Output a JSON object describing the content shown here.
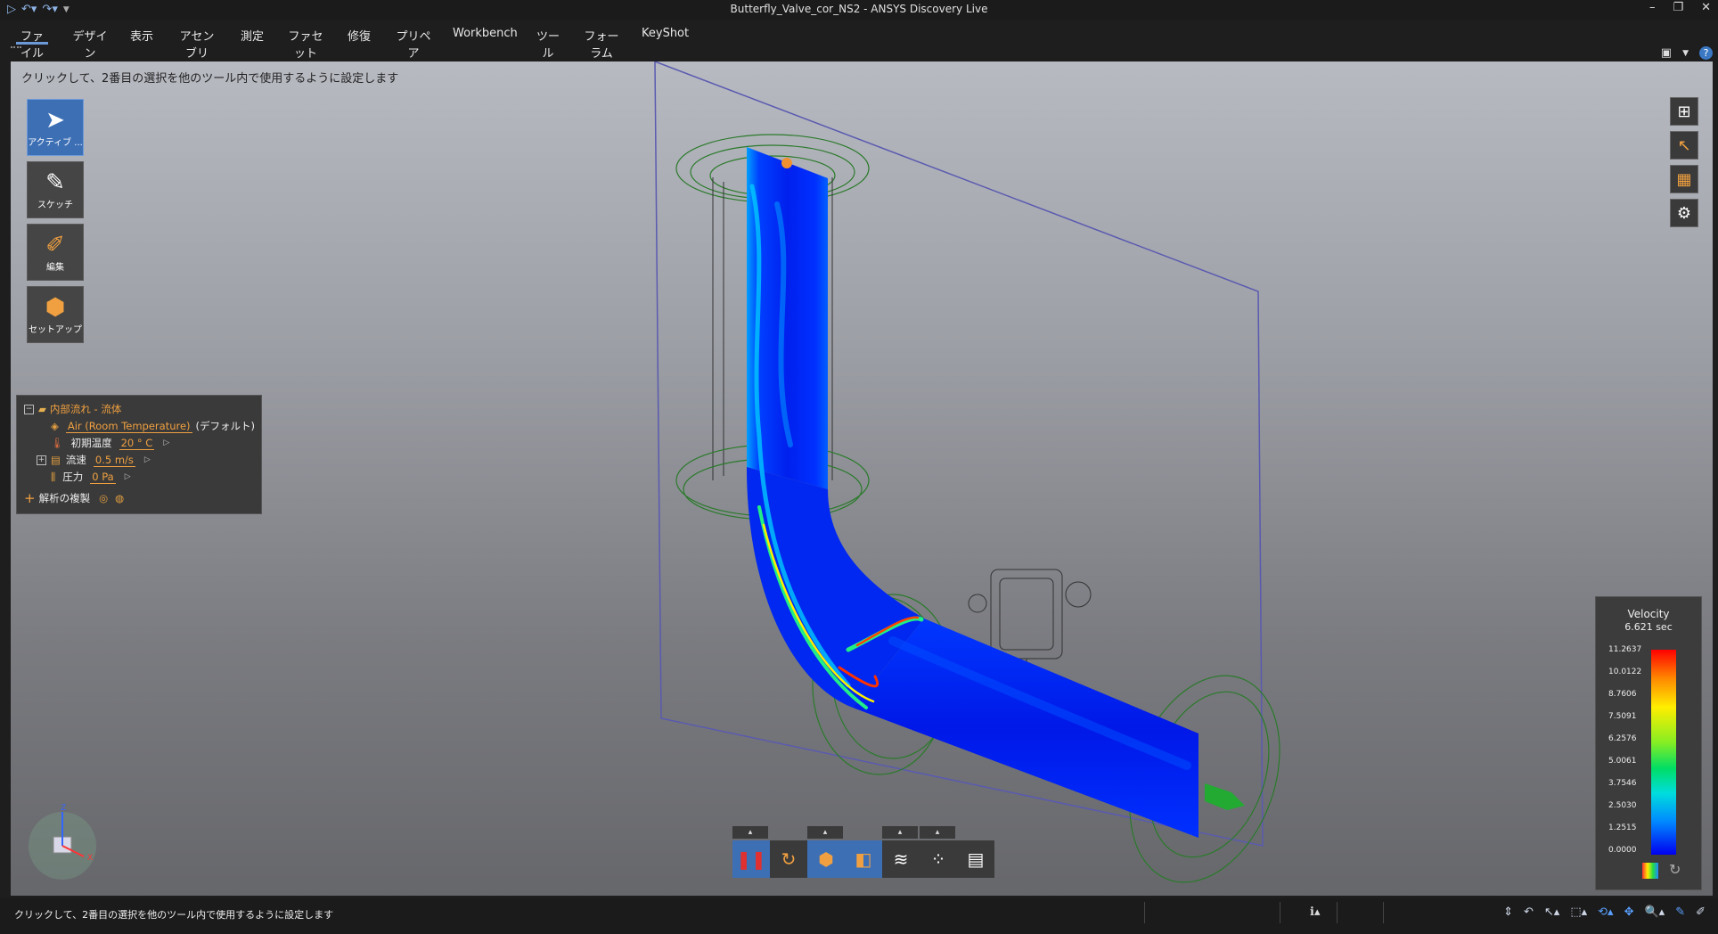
{
  "window": {
    "title": "Butterfly_Valve_cor_NS2 - ANSYS Discovery Live",
    "controls": [
      "minimize-icon",
      "restore-icon",
      "close-icon"
    ]
  },
  "quick_access": [
    "play-logo-icon",
    "undo-icon",
    "redo-icon",
    "customize-icon"
  ],
  "menu": [
    {
      "label": "ファイル",
      "active": true
    },
    {
      "label": "デザイン"
    },
    {
      "label": "表示"
    },
    {
      "label": "アセンブリ"
    },
    {
      "label": "測定"
    },
    {
      "label": "ファセット"
    },
    {
      "label": "修復"
    },
    {
      "label": "プリペア"
    },
    {
      "label": "Workbench"
    },
    {
      "label": "ツール"
    },
    {
      "label": "フォーラム"
    },
    {
      "label": "KeyShot"
    }
  ],
  "viewport": {
    "hint": "クリックして、2番目の選択を他のツール内で使用するように設定します"
  },
  "tools": [
    {
      "label": "アクティブ ...",
      "icon": "cursor-icon",
      "active": true
    },
    {
      "label": "スケッチ",
      "icon": "pencil-icon"
    },
    {
      "label": "編集",
      "icon": "edit-brush-icon"
    },
    {
      "label": "セットアップ",
      "icon": "setup-box-icon"
    }
  ],
  "physics_tree": {
    "root": "内部流れ - 流体",
    "material": "Air (Room Temperature)",
    "material_suffix": "(デフォルト)",
    "temperature_label": "初期温度",
    "temperature_value": "20 ° C",
    "velocity_label": "流速",
    "velocity_value": "0.5 m/s",
    "pressure_label": "圧力",
    "pressure_value": "0 Pa",
    "duplicate_label": "解析の複製"
  },
  "legend": {
    "title": "Velocity",
    "time": "6.621 sec",
    "ticks": [
      "11.2637",
      "10.0122",
      "8.7606",
      "7.5091",
      "6.2576",
      "5.0061",
      "3.7546",
      "2.5030",
      "1.2515",
      "0.0000"
    ],
    "colors": {
      "max": "#ff0000",
      "mid": "#88ee22",
      "min": "#0000ee"
    }
  },
  "playbar": {
    "buttons": [
      "pause-icon",
      "reset-icon",
      "solid-view-icon",
      "section-view-icon",
      "streamlines-icon",
      "particles-icon",
      "surface-texture-icon"
    ]
  },
  "status": {
    "text": "クリックして、2番目の選択を他のツール内で使用するように設定します",
    "icons": [
      "info-icon",
      "selection-filter-icon",
      "pointer-icon",
      "box-select-icon",
      "rotate-icon",
      "pan-icon",
      "zoom-icon",
      "pen-icon"
    ]
  },
  "accent": {
    "blue": "#3d6fb5",
    "orange": "#f0a040"
  }
}
